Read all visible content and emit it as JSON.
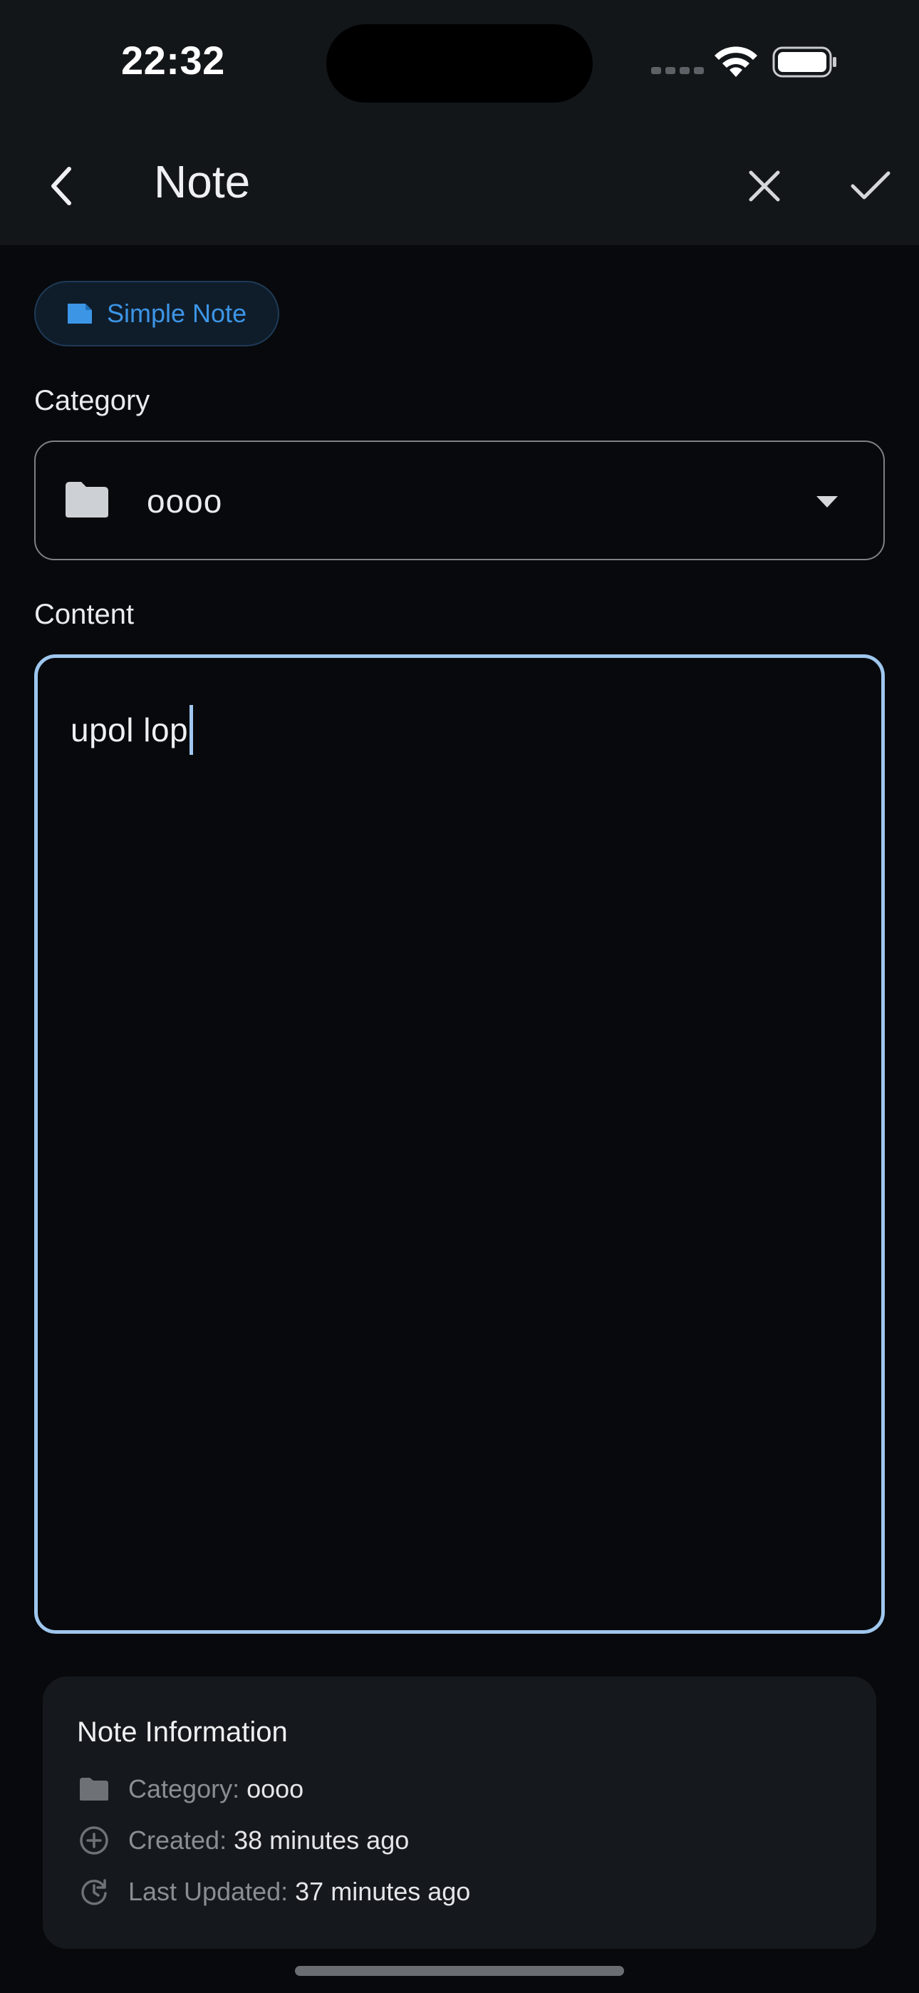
{
  "status_bar": {
    "time": "22:32"
  },
  "app_bar": {
    "title": "Note",
    "icons": {
      "back": "chevron-left-icon",
      "close": "close-icon",
      "confirm": "check-icon"
    }
  },
  "note_type_chip": {
    "label": "Simple Note",
    "icon": "note-icon",
    "color": "#3d95e6"
  },
  "category": {
    "label": "Category",
    "selected_value": "oooo",
    "icon": "folder-icon"
  },
  "content": {
    "label": "Content",
    "value": "upol lop",
    "focus_color": "#9fc7ee"
  },
  "note_information": {
    "title": "Note Information",
    "rows": [
      {
        "icon": "folder-icon",
        "key": "Category:",
        "value": "oooo"
      },
      {
        "icon": "plus-circle-icon",
        "key": "Created:",
        "value": "38 minutes ago"
      },
      {
        "icon": "history-icon",
        "key": "Last Updated:",
        "value": "37 minutes ago"
      }
    ]
  }
}
